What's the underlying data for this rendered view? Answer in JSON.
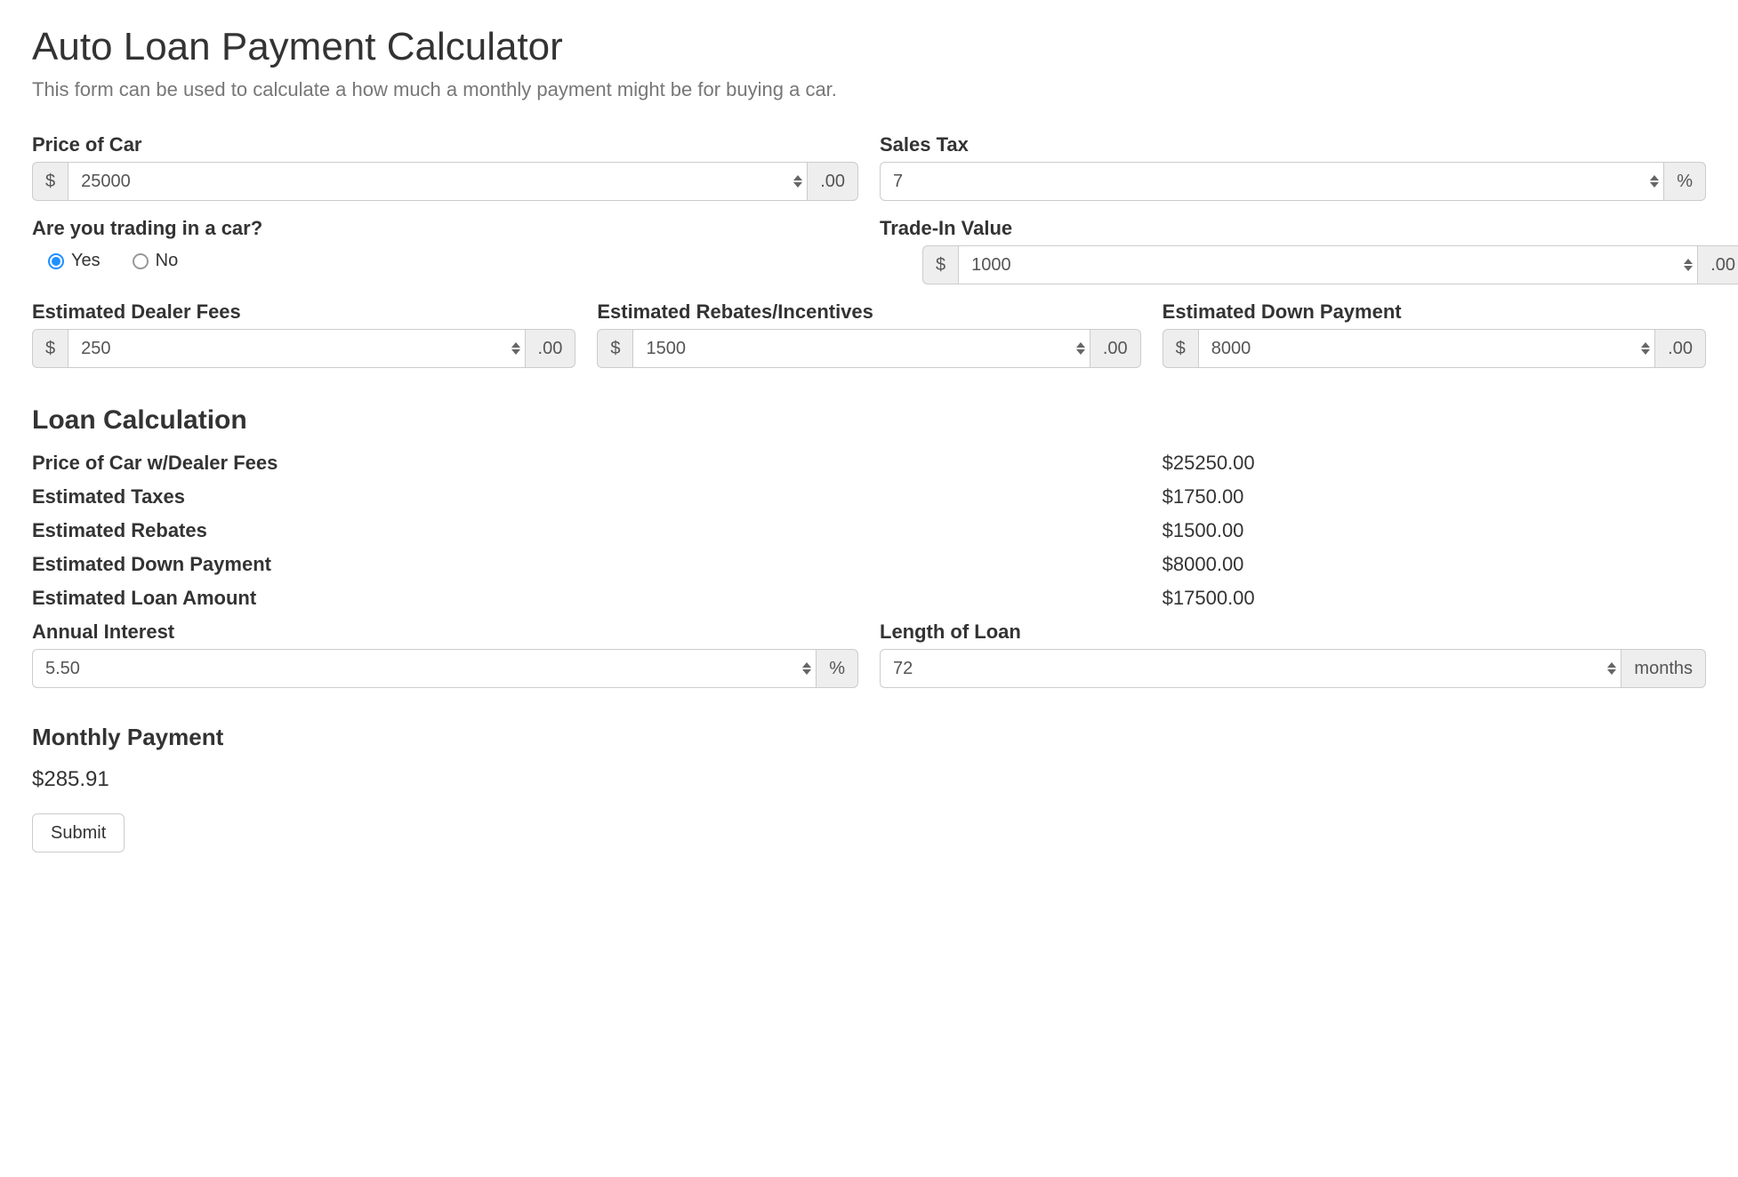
{
  "header": {
    "title": "Auto Loan Payment Calculator",
    "description": "This form can be used to calculate a how much a monthly payment might be for buying a car."
  },
  "form": {
    "price": {
      "label": "Price of Car",
      "prefix": "$",
      "value": "25000",
      "suffix": ".00"
    },
    "sales_tax": {
      "label": "Sales Tax",
      "value": "7",
      "suffix": "%"
    },
    "trading_question": {
      "label": "Are you trading in a car?",
      "options": {
        "yes": "Yes",
        "no": "No"
      },
      "selected": "yes"
    },
    "trade_in": {
      "label": "Trade-In Value",
      "prefix": "$",
      "value": "1000",
      "suffix": ".00"
    },
    "dealer_fees": {
      "label": "Estimated Dealer Fees",
      "prefix": "$",
      "value": "250",
      "suffix": ".00"
    },
    "rebates": {
      "label": "Estimated Rebates/Incentives",
      "prefix": "$",
      "value": "1500",
      "suffix": ".00"
    },
    "down_payment": {
      "label": "Estimated Down Payment",
      "prefix": "$",
      "value": "8000",
      "suffix": ".00"
    }
  },
  "calc": {
    "section_title": "Loan Calculation",
    "rows": {
      "price_with_fees": {
        "label": "Price of Car w/Dealer Fees",
        "value": "$25250.00"
      },
      "estimated_taxes": {
        "label": "Estimated Taxes",
        "value": "$1750.00"
      },
      "estimated_rebates": {
        "label": "Estimated Rebates",
        "value": "$1500.00"
      },
      "estimated_down_payment": {
        "label": "Estimated Down Payment",
        "value": "$8000.00"
      },
      "estimated_loan_amount": {
        "label": "Estimated Loan Amount",
        "value": "$17500.00"
      }
    },
    "annual_interest": {
      "label": "Annual Interest",
      "value": "5.50",
      "suffix": "%"
    },
    "length_of_loan": {
      "label": "Length of Loan",
      "value": "72",
      "suffix": "months"
    }
  },
  "result": {
    "title": "Monthly Payment",
    "value": "$285.91"
  },
  "actions": {
    "submit_label": "Submit"
  }
}
